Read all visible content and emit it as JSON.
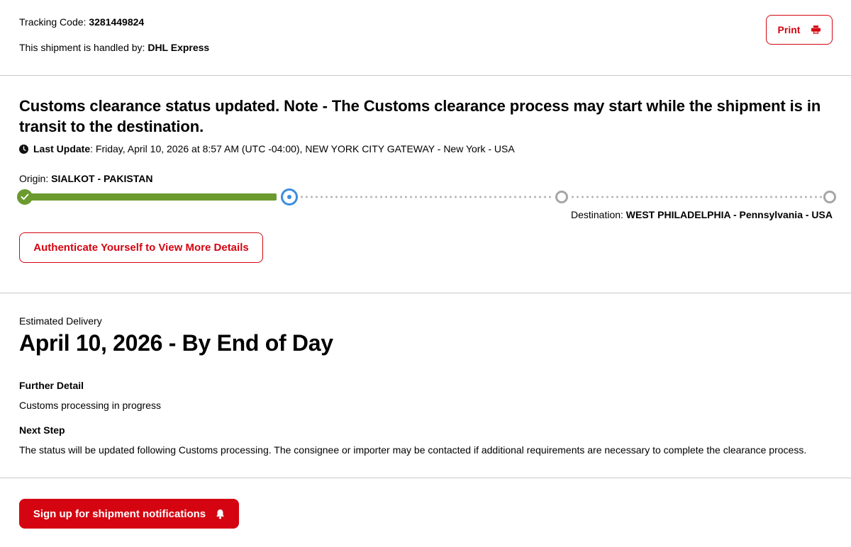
{
  "header": {
    "tracking_label": "Tracking Code:",
    "tracking_code": "3281449824",
    "handled_label": "This shipment is handled by:",
    "handled_by": "DHL Express",
    "print_label": "Print"
  },
  "status": {
    "headline": "Customs clearance status updated. Note - The Customs clearance process may start while the shipment is in transit to the destination.",
    "last_update_label": "Last Update",
    "last_update_value": ": Friday, April 10, 2026 at 8:57 AM (UTC -04:00), NEW YORK CITY GATEWAY - New York - USA",
    "origin_label": "Origin:",
    "origin_value": "SIALKOT - PAKISTAN",
    "destination_label": "Destination:",
    "destination_value": "WEST PHILADELPHIA - Pennsylvania - USA",
    "authenticate_label": "Authenticate Yourself to View More Details"
  },
  "progress": {
    "stages": [
      "completed",
      "current",
      "pending",
      "pending"
    ]
  },
  "delivery": {
    "estimated_label": "Estimated Delivery",
    "estimated_value": "April 10, 2026 - By End of Day",
    "further_detail_label": "Further Detail",
    "further_detail_value": "Customs processing in progress",
    "next_step_label": "Next Step",
    "next_step_value": "The status will be updated following Customs processing. The consignee or importer may be contacted if additional requirements are necessary to complete the clearance process."
  },
  "footer": {
    "notify_label": "Sign up for shipment notifications"
  },
  "colors": {
    "accent": "#d40511",
    "progress_complete": "#6b9a2e",
    "progress_current": "#3b8de0",
    "progress_pending": "#a6a6a6"
  },
  "icons": {
    "print": "printer-icon",
    "clock": "clock-icon",
    "check": "checkmark-icon",
    "bell": "bell-icon"
  }
}
